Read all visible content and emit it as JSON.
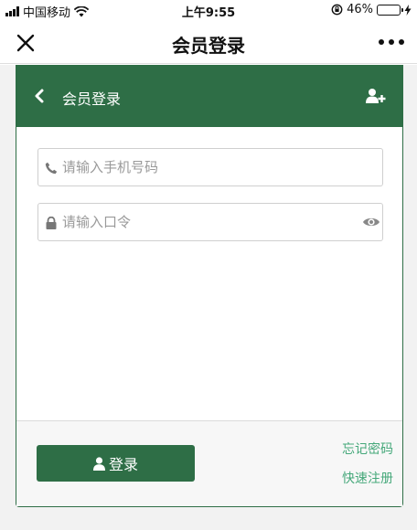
{
  "status_bar": {
    "carrier": "中国移动",
    "time": "上午9:55",
    "battery_percent": "46%",
    "battery_level": 0.46
  },
  "nav": {
    "title": "会员登录",
    "close_icon": "close-icon",
    "more_icon": "more-icon"
  },
  "card": {
    "header_title": "会员登录",
    "back_icon": "chevron-left-icon",
    "add_user_icon": "user-plus-icon"
  },
  "form": {
    "phone_placeholder": "请输入手机号码",
    "phone_value": "",
    "password_placeholder": "请输入口令",
    "password_value": ""
  },
  "footer": {
    "login_label": "登录",
    "forgot_label": "忘记密码",
    "register_label": "快速注册"
  },
  "colors": {
    "brand_green": "#2e6e46",
    "link_green": "#45a87a",
    "battery_green": "#4cd964"
  }
}
